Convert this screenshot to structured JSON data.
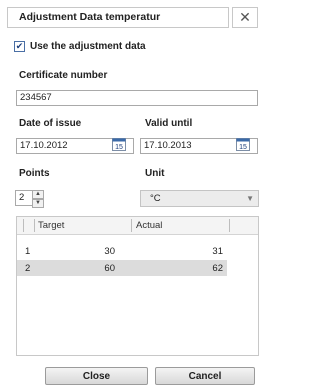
{
  "dialog": {
    "title": "Adjustment Data temperatur",
    "close_glyph": "✕"
  },
  "use_adjustment": {
    "label": "Use the adjustment data",
    "checked": true,
    "check_glyph": "✔"
  },
  "certificate": {
    "label": "Certificate number",
    "value": "234567"
  },
  "date_of_issue": {
    "label": "Date of issue",
    "value": "17.10.2012",
    "calendar_day": "15"
  },
  "valid_until": {
    "label": "Valid until",
    "value": "17.10.2013",
    "calendar_day": "15"
  },
  "points": {
    "label": "Points",
    "value": "2"
  },
  "unit": {
    "label": "Unit",
    "selected": "°C"
  },
  "table": {
    "columns": [
      "Target",
      "Actual"
    ],
    "rows": [
      {
        "index": "1",
        "target": "30",
        "actual": "31",
        "selected": false
      },
      {
        "index": "2",
        "target": "60",
        "actual": "62",
        "selected": true
      }
    ]
  },
  "buttons": {
    "close_label": "Close",
    "cancel_label": "Cancel"
  },
  "colors": {
    "selected_row": "#dcdcdc",
    "border": "#a9a9a9",
    "calendar_accent": "#3b6aa8"
  }
}
